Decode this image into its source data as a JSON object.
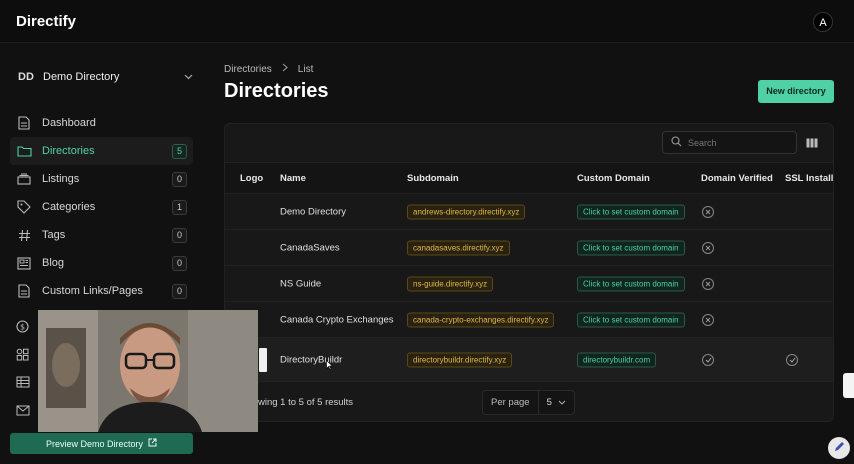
{
  "app": {
    "title": "Directify",
    "avatar_initial": "A"
  },
  "workspace": {
    "abbr": "DD",
    "name": "Demo Directory"
  },
  "sidebar": {
    "items": [
      {
        "label": "Dashboard",
        "icon": "file-icon",
        "count": null,
        "active": false
      },
      {
        "label": "Directories",
        "icon": "folder-icon",
        "count": "5",
        "active": true
      },
      {
        "label": "Listings",
        "icon": "stack-icon",
        "count": "0",
        "active": false
      },
      {
        "label": "Categories",
        "icon": "tag-icon",
        "count": "1",
        "active": false
      },
      {
        "label": "Tags",
        "icon": "hash-icon",
        "count": "0",
        "active": false
      },
      {
        "label": "Blog",
        "icon": "newspaper-icon",
        "count": "0",
        "active": false
      },
      {
        "label": "Custom Links/Pages",
        "icon": "file-icon",
        "count": "0",
        "active": false
      }
    ],
    "extra_icons": [
      "dollar-icon",
      "widgets-icon",
      "table-icon",
      "mail-icon"
    ],
    "preview_label": "Preview Demo Directory"
  },
  "breadcrumb": {
    "parent": "Directories",
    "current": "List"
  },
  "page": {
    "title": "Directories",
    "new_button": "New directory"
  },
  "search": {
    "placeholder": "Search"
  },
  "table": {
    "headers": [
      "Logo",
      "Name",
      "Subdomain",
      "Custom Domain",
      "Domain Verified",
      "SSL Installe"
    ],
    "rows": [
      {
        "name": "Demo Directory",
        "subdomain": "andrews-directory.directify.xyz",
        "custom_domain": "Click to set custom domain",
        "verified": false,
        "ssl": false,
        "logo": false
      },
      {
        "name": "CanadaSaves",
        "subdomain": "canadasaves.directify.xyz",
        "custom_domain": "Click to set custom domain",
        "verified": false,
        "ssl": false,
        "logo": false
      },
      {
        "name": "NS Guide",
        "subdomain": "ns-guide.directify.xyz",
        "custom_domain": "Click to set custom domain",
        "verified": false,
        "ssl": false,
        "logo": false
      },
      {
        "name": "Canada Crypto Exchanges",
        "subdomain": "canada-crypto-exchanges.directify.xyz",
        "custom_domain": "Click to set custom domain",
        "verified": false,
        "ssl": false,
        "logo": false
      },
      {
        "name": "DirectoryBuildr",
        "subdomain": "directorybuildr.directify.xyz",
        "custom_domain": "directorybuildr.com",
        "verified": true,
        "ssl": true,
        "logo": true
      }
    ]
  },
  "footer": {
    "results_text": "wing 1 to 5 of 5 results",
    "per_page_label": "Per page",
    "per_page_value": "5"
  },
  "colors": {
    "accent": "#4fd1a5",
    "accent_dark": "#1f6a52",
    "subdomain_tag": "#e0b84a",
    "background": "#111111",
    "card": "#181818"
  }
}
